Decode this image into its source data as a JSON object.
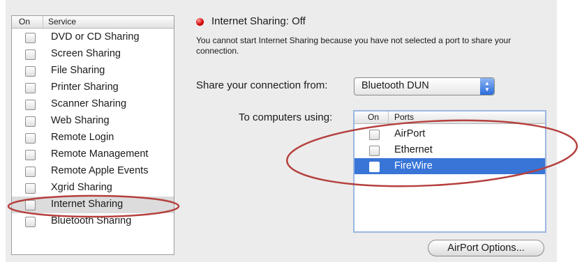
{
  "services": {
    "header": {
      "on": "On",
      "service": "Service"
    },
    "items": [
      {
        "label": "DVD or CD Sharing",
        "checked": false
      },
      {
        "label": "Screen Sharing",
        "checked": false
      },
      {
        "label": "File Sharing",
        "checked": false
      },
      {
        "label": "Printer Sharing",
        "checked": false
      },
      {
        "label": "Scanner Sharing",
        "checked": false
      },
      {
        "label": "Web Sharing",
        "checked": false
      },
      {
        "label": "Remote Login",
        "checked": false
      },
      {
        "label": "Remote Management",
        "checked": false
      },
      {
        "label": "Remote Apple Events",
        "checked": false
      },
      {
        "label": "Xgrid Sharing",
        "checked": false
      },
      {
        "label": "Internet Sharing",
        "checked": false,
        "selected": true
      },
      {
        "label": "Bluetooth Sharing",
        "checked": false
      }
    ]
  },
  "status": {
    "title": "Internet Sharing: Off",
    "description": "You cannot start Internet Sharing because you have not selected a port to share your connection.",
    "indicator_color": "#d40000"
  },
  "share_from": {
    "label": "Share your connection from:",
    "value": "Bluetooth DUN"
  },
  "to_computers": {
    "label": "To computers using:",
    "header": {
      "on": "On",
      "ports": "Ports"
    },
    "ports": [
      {
        "label": "AirPort",
        "checked": false
      },
      {
        "label": "Ethernet",
        "checked": false
      },
      {
        "label": "FireWire",
        "checked": false,
        "selected": true
      }
    ]
  },
  "airport_options_button": "AirPort Options...",
  "colors": {
    "selection": "#3875d7",
    "annotation": "#b5403e"
  }
}
